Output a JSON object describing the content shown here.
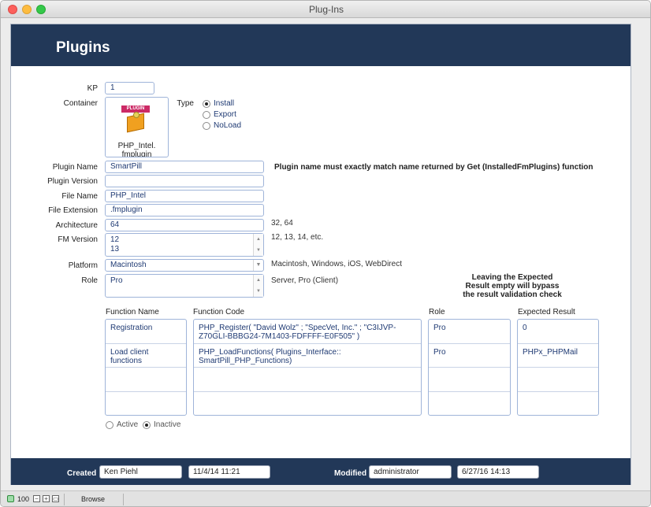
{
  "window": {
    "title": "Plug-Ins"
  },
  "header": {
    "title": "Plugins"
  },
  "form": {
    "kp_label": "KP",
    "kp_value": "1",
    "container_label": "Container",
    "container_badge": "PLUGIN",
    "container_filename": "PHP_Intel.",
    "container_filename2": "fmplugin",
    "type_label": "Type",
    "type_options": [
      "Install",
      "Export",
      "NoLoad"
    ],
    "type_selected": "Install",
    "plugin_name_label": "Plugin Name",
    "plugin_name_value": "SmartPill",
    "plugin_name_hint": "Plugin name must exactly match name returned by Get (InstalledFmPlugins) function",
    "plugin_version_label": "Plugin Version",
    "plugin_version_value": "",
    "file_name_label": "File Name",
    "file_name_value": "PHP_Intel",
    "file_extension_label": "File Extension",
    "file_extension_value": ".fmplugin",
    "architecture_label": "Architecture",
    "architecture_value": "64",
    "architecture_hint": "32, 64",
    "fm_version_label": "FM Version",
    "fm_version_values": [
      "12",
      "13"
    ],
    "fm_version_hint": "12, 13, 14, etc.",
    "platform_label": "Platform",
    "platform_value": "Macintosh",
    "platform_hint": "Macintosh, Windows, iOS, WebDirect",
    "role_label": "Role",
    "role_value": "Pro",
    "role_hint": "Server, Pro (Client)",
    "note_lines": [
      "Leaving the Expected",
      "Result empty will bypass",
      "the result validation check"
    ]
  },
  "functions": {
    "columns": [
      "Function Name",
      "Function Code",
      "Role",
      "Expected Result"
    ],
    "rows": [
      {
        "name": "Registration",
        "code": "PHP_Register( \"David Wolz\" ; \"SpecVet, Inc.\" ; \"C3IJVP-Z70GLI-BBBG24-7M1403-FDFFFF-E0F505\" )",
        "role": "Pro",
        "expected": "0"
      },
      {
        "name": "Load client functions",
        "code": "PHP_LoadFunctions( Plugins_Interface:: SmartPill_PHP_Functions)",
        "role": "Pro",
        "expected": "PHPx_PHPMail"
      },
      {
        "name": "",
        "code": "",
        "role": "",
        "expected": ""
      },
      {
        "name": "",
        "code": "",
        "role": "",
        "expected": ""
      }
    ],
    "status_options": [
      "Active",
      "Inactive"
    ],
    "status_selected": "Inactive"
  },
  "footer": {
    "created_label": "Created",
    "created_by": "Ken Piehl",
    "created_on": "11/4/14 11:21",
    "modified_label": "Modified",
    "modified_by": "administrator",
    "modified_on": "6/27/16 14:13"
  },
  "statusbar": {
    "zoom": "100",
    "mode": "Browse"
  }
}
